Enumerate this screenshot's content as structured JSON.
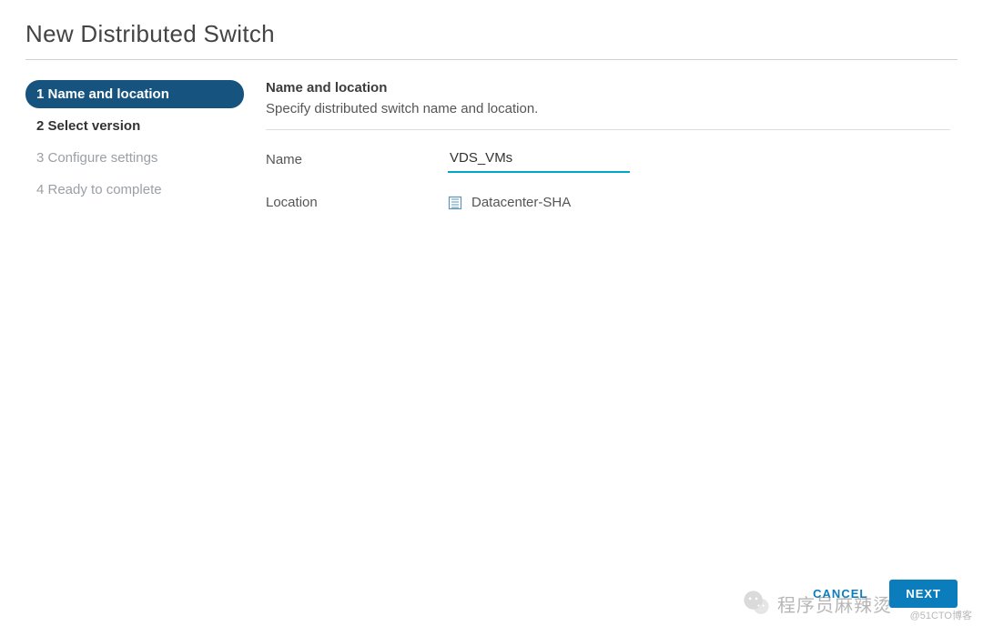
{
  "title": "New Distributed Switch",
  "steps": [
    {
      "label": "1 Name and location",
      "state": "active"
    },
    {
      "label": "2 Select version",
      "state": "enabled"
    },
    {
      "label": "3 Configure settings",
      "state": "disabled"
    },
    {
      "label": "4 Ready to complete",
      "state": "disabled"
    }
  ],
  "section": {
    "heading": "Name and location",
    "subheading": "Specify distributed switch name and location."
  },
  "fields": {
    "name_label": "Name",
    "name_value": "VDS_VMs",
    "location_label": "Location",
    "location_value": "Datacenter-SHA"
  },
  "footer": {
    "cancel": "CANCEL",
    "next": "NEXT"
  },
  "watermark": {
    "text": "程序员麻辣烫",
    "source": "@51CTO博客"
  }
}
